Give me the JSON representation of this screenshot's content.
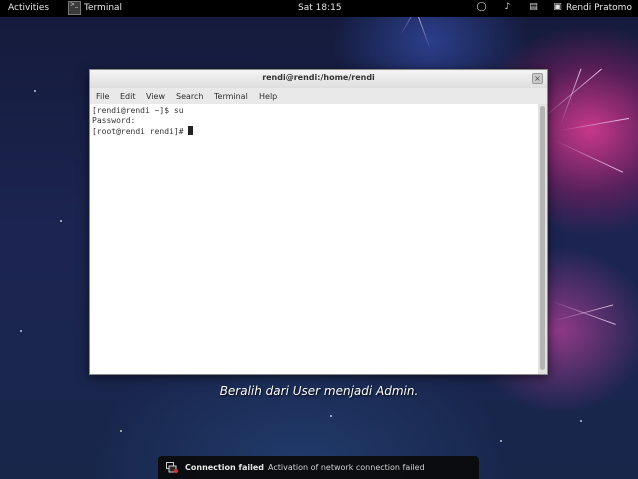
{
  "topbar": {
    "activities": "Activities",
    "app_name": "Terminal",
    "clock": "Sat 18:15",
    "user_name": "Rendi Pratomo"
  },
  "window": {
    "title": "rendi@rendi:/home/rendi",
    "menu": [
      "File",
      "Edit",
      "View",
      "Search",
      "Terminal",
      "Help"
    ],
    "terminal_lines": [
      "[rendi@rendi ~]$ su",
      "Password:",
      "[root@rendi rendi]# "
    ]
  },
  "caption": "Beralih dari User menjadi Admin.",
  "notification": {
    "title": "Connection failed",
    "body": "Activation of network connection failed"
  },
  "colors": {
    "topbar_bg": "#000000",
    "terminal_bg": "#ffffff",
    "desktop_accent": "#d63c96"
  },
  "icons": {
    "accessibility": "accessibility-icon",
    "volume": "volume-icon",
    "network": "network-icon",
    "user": "user-icon",
    "app": "terminal-app-icon",
    "notification": "network-error-icon"
  }
}
